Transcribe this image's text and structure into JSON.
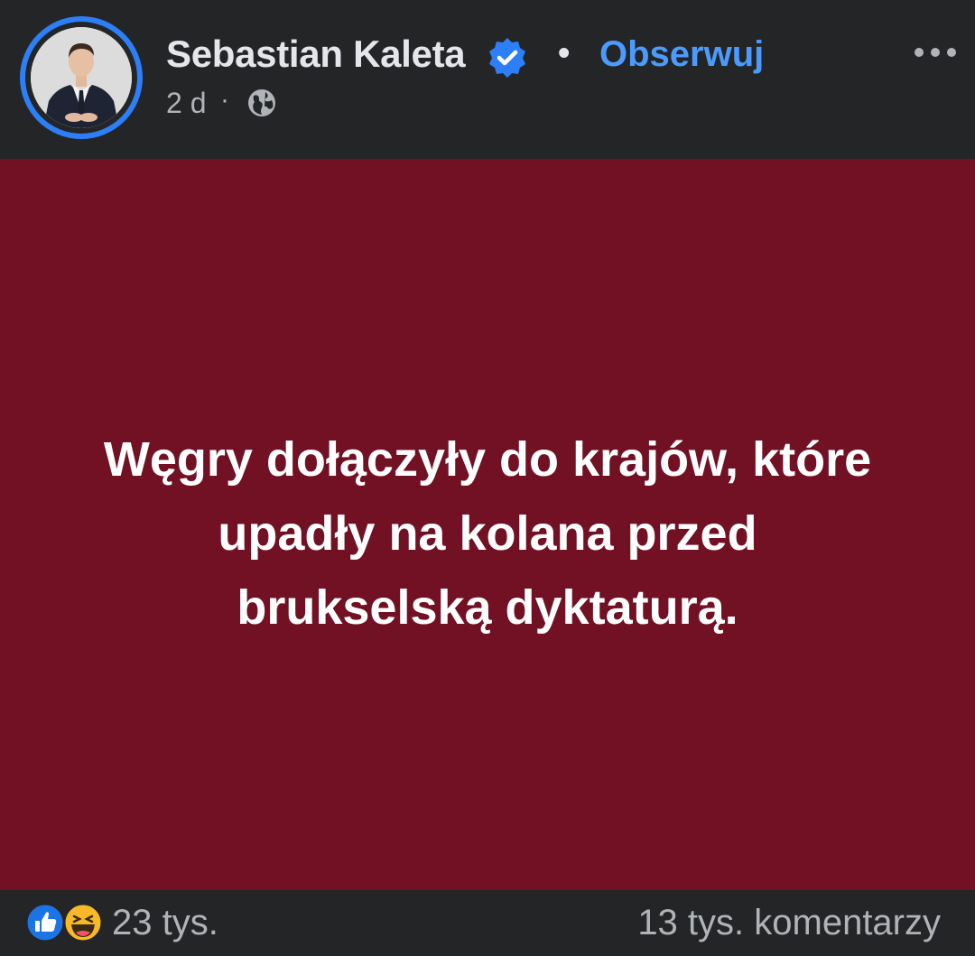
{
  "header": {
    "author": "Sebastian Kaleta",
    "separator": "•",
    "follow_label": "Obserwuj",
    "time": "2 d",
    "time_separator": "·",
    "verified_icon": "verified-badge-icon",
    "privacy_icon": "globe-icon",
    "more_icon": "more-options-icon"
  },
  "content": {
    "background_color": "#721024",
    "text": "Węgry dołączyły do krajów, które\nupadły na kolana przed\nbrukselską dyktaturą."
  },
  "footer": {
    "reaction_icons": [
      "like-icon",
      "haha-icon"
    ],
    "reactions_count": "23 tys.",
    "comments_count": "13 tys. komentarzy"
  },
  "colors": {
    "background": "#242526",
    "accent": "#4b9bff",
    "verified": "#2d7ff9",
    "text_primary": "#e4e6eb",
    "text_secondary": "#b0b3b8"
  }
}
